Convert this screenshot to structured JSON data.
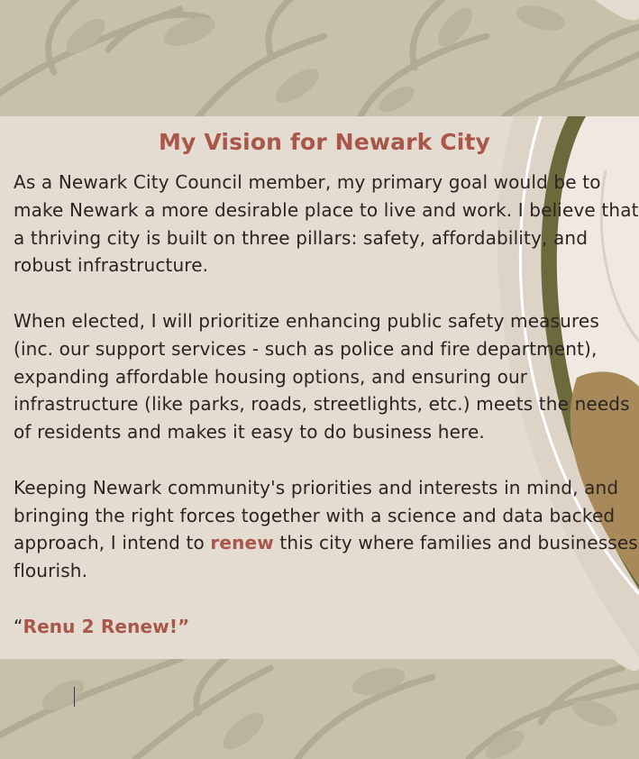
{
  "page": {
    "title": "My Vision for Newark City",
    "paragraphs": [
      "As a Newark City Council member, my primary goal would be to make Newark a more desirable place to live and work. I believe that a thriving city is built on three pillars: safety, affordability, and robust infrastructure.",
      "When elected, I will prioritize enhancing public safety measures (inc. our support services - such as police and fire department), expanding affordable housing options, and ensuring our infrastructure (like parks, roads, streetlights, etc.) meets the needs of residents and makes it easy to do business here."
    ],
    "closing": {
      "before": "Keeping Newark community's priorities and interests in mind, and bringing the right forces together with a science and data backed approach, I intend to ",
      "highlight": "renew",
      "after": " this city where families and businesses flourish."
    },
    "slogan": {
      "open_quote": "“",
      "text": "Renu 2 Renew!”"
    }
  },
  "colors": {
    "band": "#c7c1aa",
    "leaf": "#b3aa93",
    "panel": "#e4dbd1",
    "accent": "#a8574a",
    "text": "#2a2422"
  }
}
